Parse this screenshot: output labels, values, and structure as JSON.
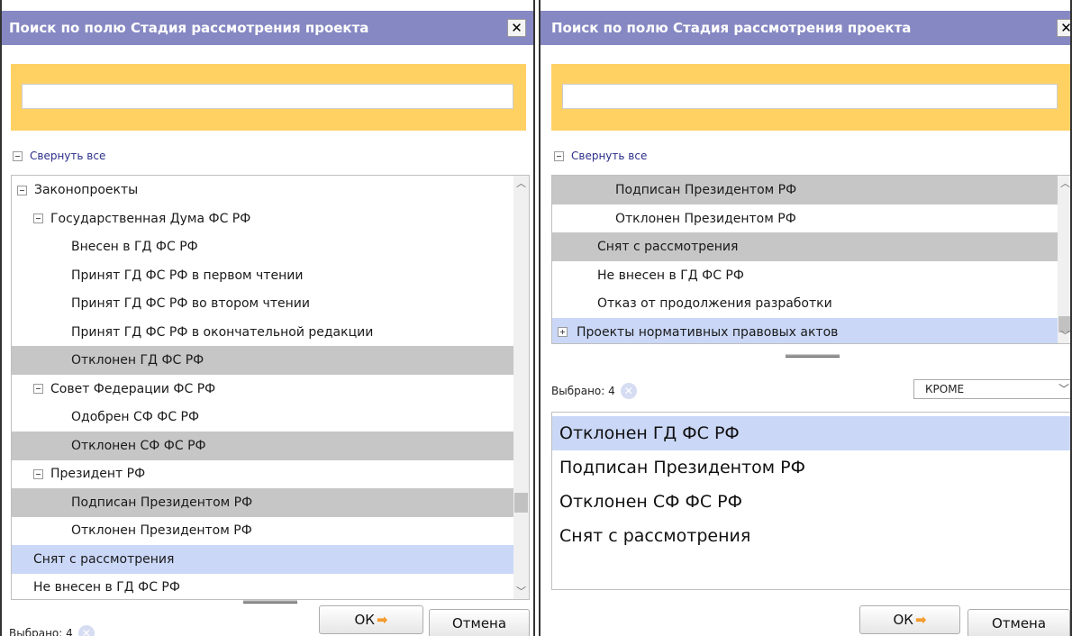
{
  "left_dialog": {
    "title": "Поиск по полю Стадия рассмотрения проекта",
    "close_glyph": "✕",
    "collapse_all": "Свернуть все",
    "tree": [
      {
        "label": "Законопроекты",
        "toggle": "minus",
        "level": 0,
        "state": "normal"
      },
      {
        "label": "Государственная Дума ФС РФ",
        "toggle": "minus",
        "level": 1,
        "state": "normal"
      },
      {
        "label": "Внесен в ГД ФС РФ",
        "toggle": "none",
        "level": 2,
        "state": "normal"
      },
      {
        "label": "Принят ГД ФС РФ в первом чтении",
        "toggle": "none",
        "level": 2,
        "state": "normal"
      },
      {
        "label": "Принят ГД ФС РФ во втором чтении",
        "toggle": "none",
        "level": 2,
        "state": "normal"
      },
      {
        "label": "Принят ГД ФС РФ в окончательной редакции",
        "toggle": "none",
        "level": 2,
        "state": "normal"
      },
      {
        "label": "Отклонен ГД ФС РФ",
        "toggle": "none",
        "level": 2,
        "state": "grey"
      },
      {
        "label": "Совет Федерации ФС РФ",
        "toggle": "minus",
        "level": 1,
        "state": "normal"
      },
      {
        "label": "Одобрен СФ ФС РФ",
        "toggle": "none",
        "level": 2,
        "state": "normal"
      },
      {
        "label": "Отклонен СФ ФС РФ",
        "toggle": "none",
        "level": 2,
        "state": "grey"
      },
      {
        "label": "Президент РФ",
        "toggle": "minus",
        "level": 1,
        "state": "normal"
      },
      {
        "label": "Подписан Президентом РФ",
        "toggle": "none",
        "level": 2,
        "state": "grey"
      },
      {
        "label": "Отклонен Президентом РФ",
        "toggle": "none",
        "level": 2,
        "state": "normal"
      },
      {
        "label": "Снят с рассмотрения",
        "toggle": "none",
        "level": 1,
        "state": "blue"
      },
      {
        "label": "Не внесен в ГД ФС РФ",
        "toggle": "none",
        "level": 1,
        "state": "normal"
      }
    ],
    "selected_count_label": "Выбрано: 4",
    "ok_label": "ОК",
    "cancel_label": "Отмена"
  },
  "right_dialog": {
    "title": "Поиск по полю Стадия рассмотрения проекта",
    "close_glyph": "✕",
    "collapse_all": "Свернуть все",
    "tree": [
      {
        "label": "Подписан Президентом РФ",
        "toggle": "none",
        "level": 2,
        "state": "grey"
      },
      {
        "label": "Отклонен Президентом РФ",
        "toggle": "none",
        "level": 2,
        "state": "normal"
      },
      {
        "label": "Снят с рассмотрения",
        "toggle": "none",
        "level": 1,
        "state": "grey"
      },
      {
        "label": "Не внесен в ГД ФС РФ",
        "toggle": "none",
        "level": 1,
        "state": "normal"
      },
      {
        "label": "Отказ от продолжения разработки",
        "toggle": "none",
        "level": 1,
        "state": "normal"
      },
      {
        "label": "Проекты нормативных правовых актов",
        "toggle": "plus",
        "level": 0,
        "state": "blue"
      }
    ],
    "selected_count_label": "Выбрано: 4",
    "mode_select": "КРОМЕ",
    "selected_items": [
      {
        "label": "Отклонен ГД ФС РФ",
        "state": "blue"
      },
      {
        "label": "Подписан Президентом РФ",
        "state": "normal"
      },
      {
        "label": "Отклонен СФ ФС РФ",
        "state": "normal"
      },
      {
        "label": "Снят с рассмотрения",
        "state": "normal"
      }
    ],
    "ok_label": "ОК",
    "cancel_label": "Отмена"
  },
  "icons": {
    "ok_arrow": "➡",
    "clear": "✕",
    "scroll_up": "︿",
    "scroll_down": "﹀",
    "chevron_down": "﹀"
  },
  "colors": {
    "titlebar": "#8688c3",
    "search_band": "#ffd163",
    "row_grey": "#c6c6c6",
    "row_blue": "#cad7f7",
    "ok_arrow": "#f39b2d"
  }
}
